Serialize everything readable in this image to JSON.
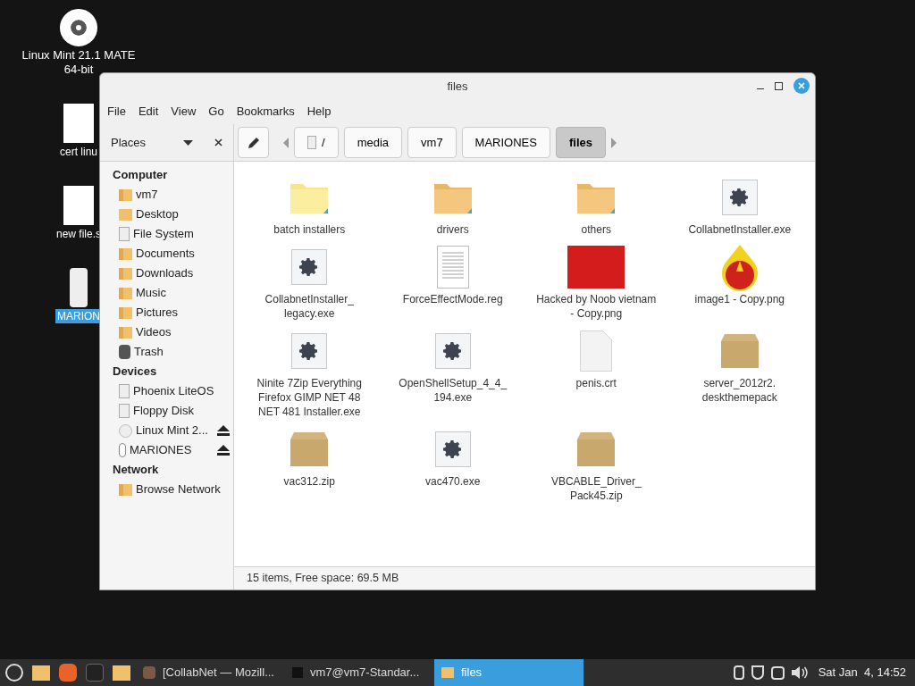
{
  "desktop_icons": [
    {
      "kind": "disc",
      "label": "Linux Mint 21.1 MATE 64-bit",
      "selected": false
    },
    {
      "kind": "doc",
      "label": "cert linu",
      "selected": false
    },
    {
      "kind": "doc",
      "label": "new file.s",
      "selected": false
    },
    {
      "kind": "usb",
      "label": "MARION",
      "selected": true
    }
  ],
  "window": {
    "title": "files",
    "menu": [
      "File",
      "Edit",
      "View",
      "Go",
      "Bookmarks",
      "Help"
    ],
    "sidebar": {
      "header": "Places",
      "sections": [
        {
          "title": "Computer",
          "items": [
            {
              "kind": "home",
              "label": "vm7"
            },
            {
              "kind": "folder",
              "label": "Desktop"
            },
            {
              "kind": "drive",
              "label": "File System"
            },
            {
              "kind": "documents",
              "label": "Documents"
            },
            {
              "kind": "downloads",
              "label": "Downloads"
            },
            {
              "kind": "music",
              "label": "Music"
            },
            {
              "kind": "pictures",
              "label": "Pictures"
            },
            {
              "kind": "videos",
              "label": "Videos"
            },
            {
              "kind": "trash",
              "label": "Trash"
            }
          ]
        },
        {
          "title": "Devices",
          "items": [
            {
              "kind": "drive",
              "label": "Phoenix LiteOS",
              "eject": false
            },
            {
              "kind": "floppy",
              "label": "Floppy Disk",
              "eject": false
            },
            {
              "kind": "disc",
              "label": "Linux Mint 2...",
              "eject": true
            },
            {
              "kind": "usb",
              "label": "MARIONES",
              "eject": true
            }
          ]
        },
        {
          "title": "Network",
          "items": [
            {
              "kind": "network",
              "label": "Browse Network"
            }
          ]
        }
      ]
    },
    "path": [
      {
        "label": "/",
        "root": true,
        "selected": false
      },
      {
        "label": "media",
        "selected": false
      },
      {
        "label": "vm7",
        "selected": false
      },
      {
        "label": "MARIONES",
        "selected": false
      },
      {
        "label": "files",
        "selected": true
      }
    ],
    "files": [
      {
        "kind": "folder",
        "name": "batch installers",
        "highlighted": true
      },
      {
        "kind": "folder",
        "name": "drivers",
        "highlighted": false
      },
      {
        "kind": "folder",
        "name": "others",
        "highlighted": false
      },
      {
        "kind": "exe",
        "name": "CollabnetInstaller.exe"
      },
      {
        "kind": "exe",
        "name": "CollabnetInstaller_ legacy.exe"
      },
      {
        "kind": "doc",
        "name": "ForceEffectMode.reg"
      },
      {
        "kind": "photo",
        "name": "Hacked by Noob vietnam - Copy.png"
      },
      {
        "kind": "drawing",
        "name": "image1 - Copy.png"
      },
      {
        "kind": "exe",
        "name": "Ninite 7Zip Everything Firefox GIMP NET 48 NET 481 Installer.exe"
      },
      {
        "kind": "exe",
        "name": "OpenShellSetup_4_4_ 194.exe"
      },
      {
        "kind": "blank",
        "name": "penis.crt"
      },
      {
        "kind": "archive",
        "name": "server_2012r2. deskthemepack"
      },
      {
        "kind": "archive",
        "name": "vac312.zip"
      },
      {
        "kind": "exe",
        "name": "vac470.exe"
      },
      {
        "kind": "archive",
        "name": "VBCABLE_Driver_ Pack45.zip"
      }
    ],
    "status": "15 items, Free space: 69.5 MB"
  },
  "taskbar": {
    "launchers": [
      {
        "kind": "menu"
      },
      {
        "kind": "folder"
      },
      {
        "kind": "browser"
      },
      {
        "kind": "terminal"
      },
      {
        "kind": "folder"
      }
    ],
    "windows": [
      {
        "kind": "browser",
        "label": "[CollabNet — Mozill...",
        "selected": false
      },
      {
        "kind": "terminal",
        "label": "vm7@vm7-Standar...",
        "selected": false
      },
      {
        "kind": "folder",
        "label": "files",
        "selected": true
      }
    ],
    "clock": "Sat Jan  4, 14:52"
  }
}
